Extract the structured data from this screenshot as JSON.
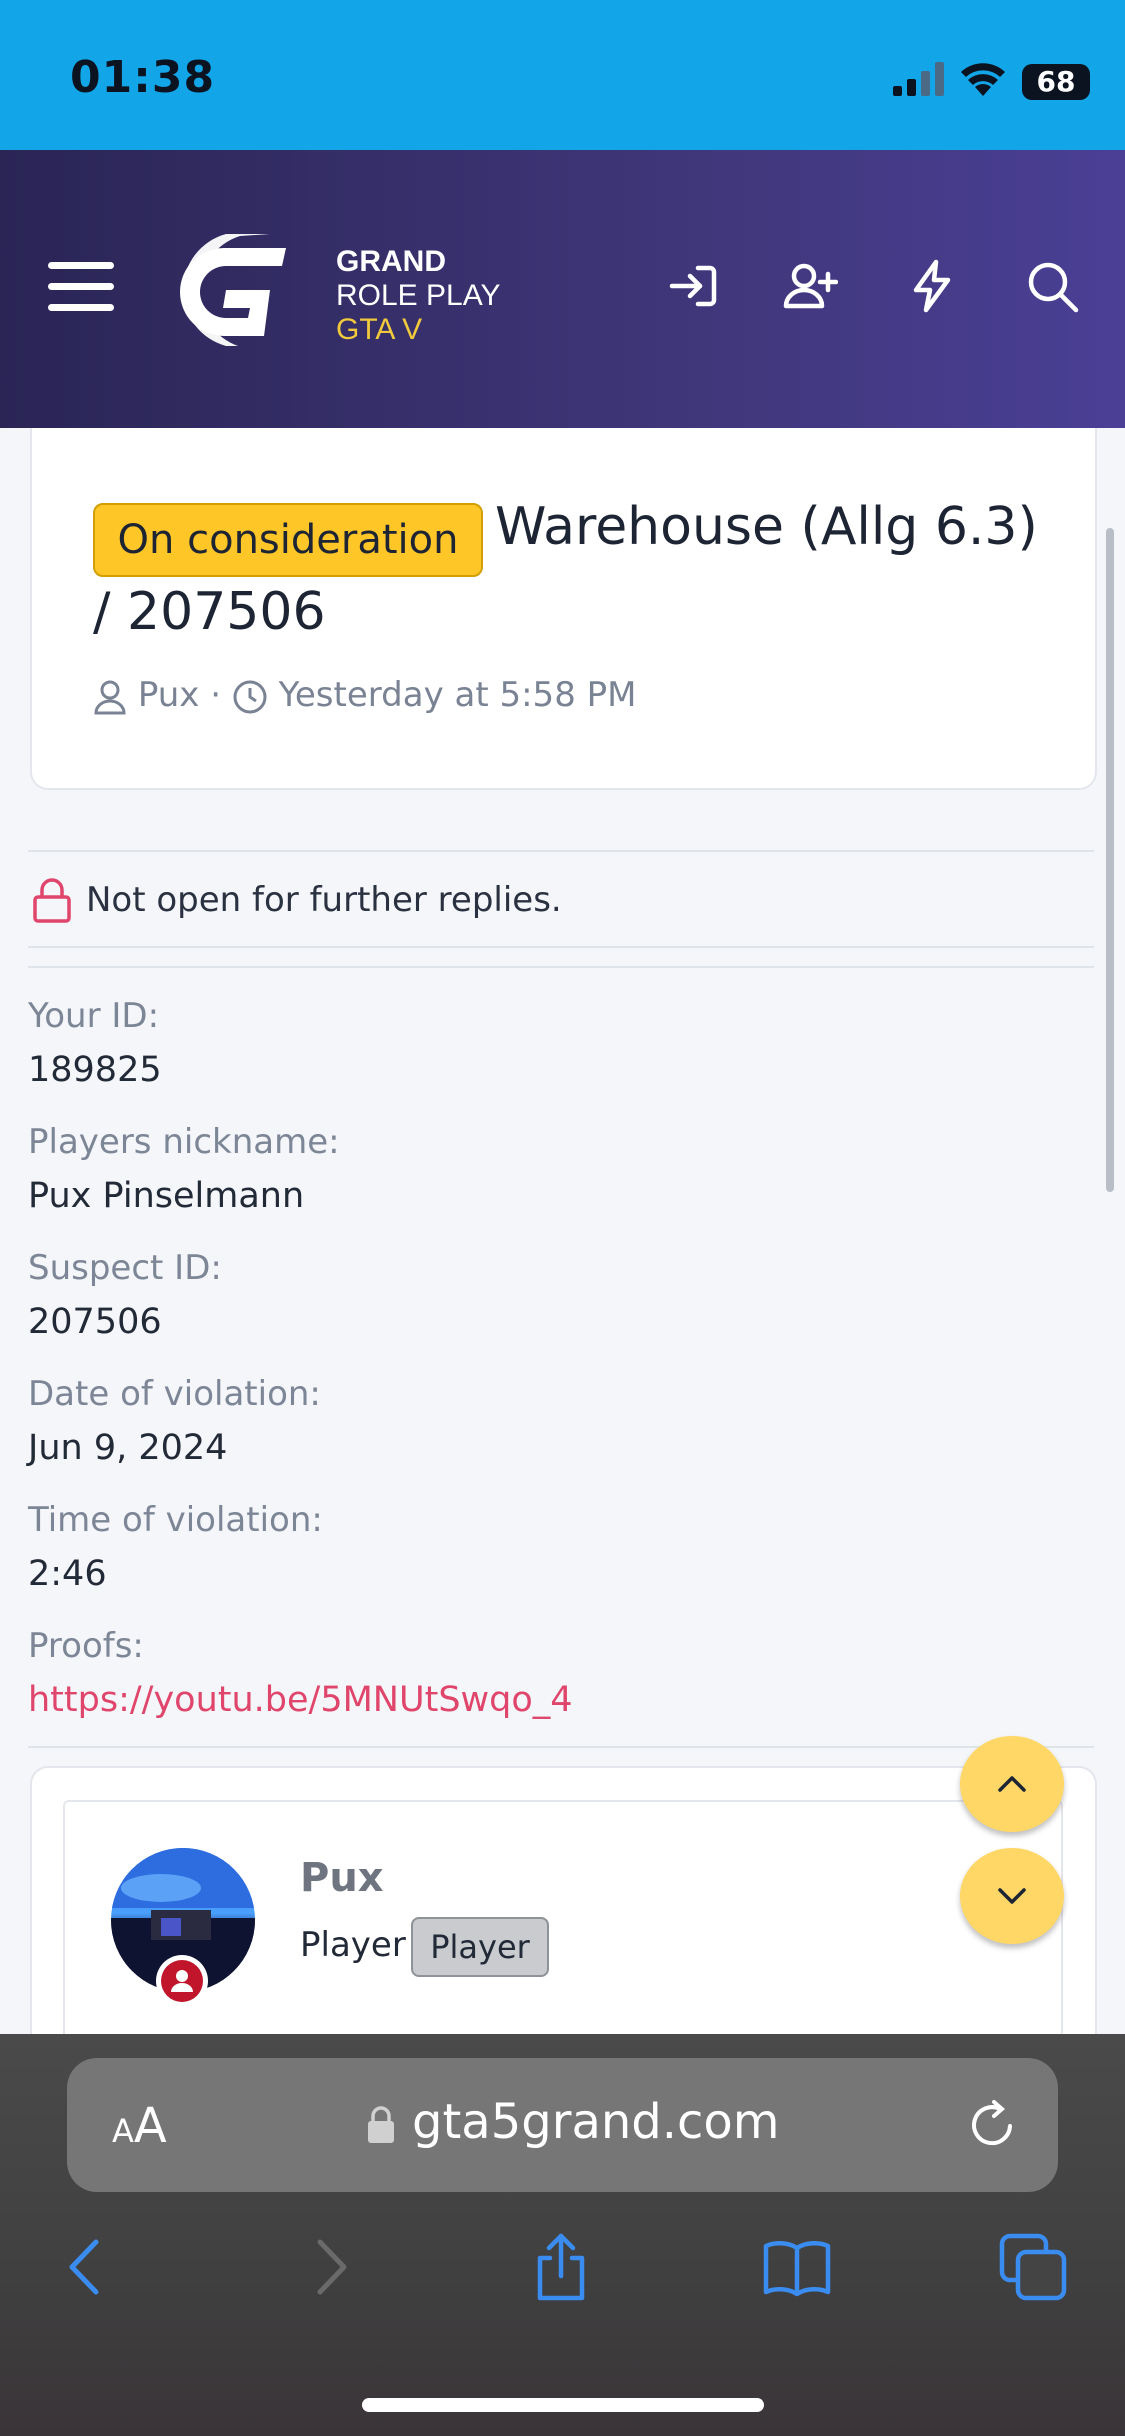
{
  "status_bar": {
    "time": "01:38",
    "battery": "68"
  },
  "header": {
    "logo_line1": "GRAND",
    "logo_line2": "ROLE PLAY",
    "logo_line3": "GTA V",
    "icons": [
      "login-icon",
      "register-icon",
      "whats-new-icon",
      "search-icon"
    ]
  },
  "thread": {
    "status_badge": "On consideration",
    "title_line1": "Warehouse (Allg 6.3)",
    "title_line2": "/ 207506",
    "author": "Pux",
    "separator": "·",
    "date": "Yesterday at 5:58 PM"
  },
  "notice": {
    "text": "Not open for further replies."
  },
  "fields": [
    {
      "label": "Your ID:",
      "value": "189825"
    },
    {
      "label": "Players nickname:",
      "value": "Pux Pinselmann"
    },
    {
      "label": "Suspect ID:",
      "value": "207506"
    },
    {
      "label": "Date of violation:",
      "value": "Jun 9, 2024"
    },
    {
      "label": "Time of violation:",
      "value": "2:46"
    },
    {
      "label": "Proofs:",
      "value": "https://youtu.be/5MNUtSwqo_4"
    }
  ],
  "post": {
    "username": "Pux",
    "role": "Player",
    "role_badge": "Player"
  },
  "browser": {
    "aa_small": "A",
    "aa_large": "A",
    "url": "gta5grand.com"
  }
}
